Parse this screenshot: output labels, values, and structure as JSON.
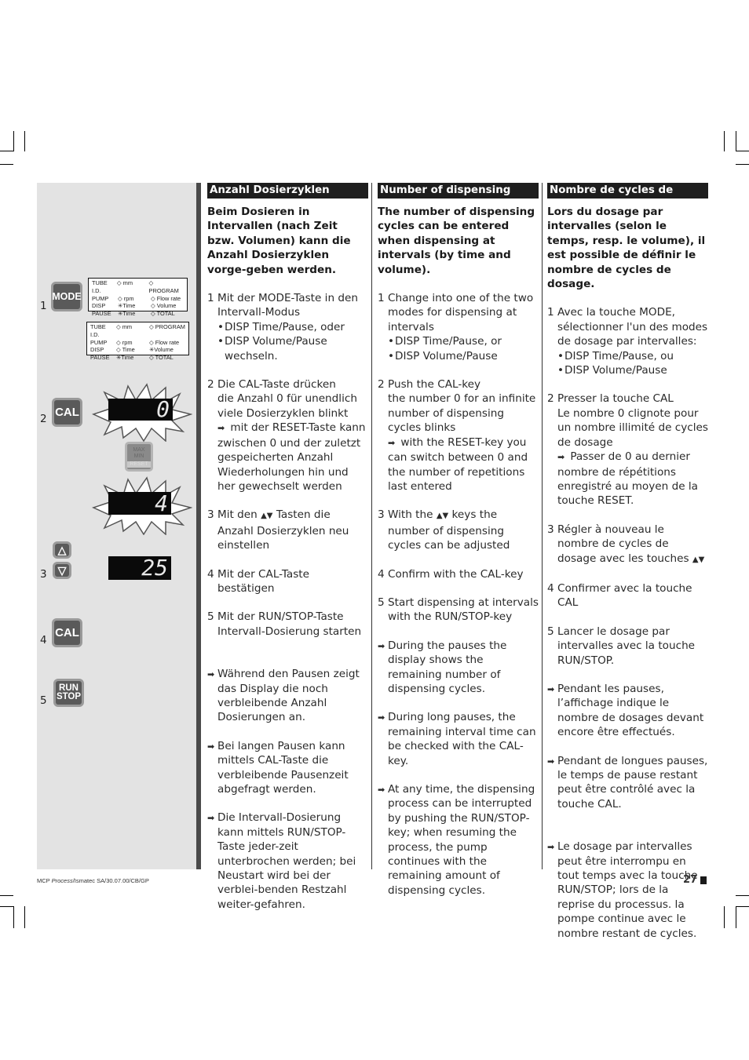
{
  "sidebar": {
    "steps": [
      {
        "num": "1",
        "key": "MODE"
      },
      {
        "num": "2",
        "key": "CAL"
      },
      {
        "num": "3",
        "key_up": "△",
        "key_down": "▽"
      },
      {
        "num": "4",
        "key": "CAL"
      },
      {
        "num": "5",
        "key_line1": "RUN",
        "key_line2": "STOP"
      }
    ],
    "mode_panel_1": {
      "rows": [
        {
          "label": "TUBE I.D.",
          "mid_mark": "◇",
          "mid": "mm",
          "right_mark": "◇",
          "right": "PROGRAM"
        },
        {
          "label": "PUMP",
          "mid_mark": "◇",
          "mid": "rpm",
          "right_mark": "◇",
          "right": "Flow rate"
        },
        {
          "label": "DISP",
          "mid_mark": "✳",
          "mid": "Time",
          "right_mark": "◇",
          "right": "Volume"
        },
        {
          "label": "PAUSE",
          "mid_mark": "✳",
          "mid": "Time",
          "right_mark": "◇",
          "right": "TOTAL"
        }
      ]
    },
    "mode_panel_2": {
      "rows": [
        {
          "label": "TUBE I.D.",
          "mid_mark": "◇",
          "mid": "mm",
          "right_mark": "◇",
          "right": "PROGRAM"
        },
        {
          "label": "PUMP",
          "mid_mark": "◇",
          "mid": "rpm",
          "right_mark": "◇",
          "right": "Flow rate"
        },
        {
          "label": "DISP",
          "mid_mark": "◇",
          "mid": "Time",
          "right_mark": "✳",
          "right": "Volume"
        },
        {
          "label": "PAUSE",
          "mid_mark": "✳",
          "mid": "Time",
          "right_mark": "◇",
          "right": "TOTAL"
        }
      ]
    },
    "display_1": "0",
    "reset_key": {
      "line1": "MAX",
      "line2": "MIN",
      "line3": "RESET"
    },
    "display_2": "4",
    "display_3": "25"
  },
  "columns": [
    {
      "header": "Anzahl Dosierzyklen",
      "intro": "Beim Dosieren in Intervallen (nach Zeit bzw. Volumen) kann die Anzahl Dosierzyklen vorge-geben werden.",
      "step1": {
        "num": "1",
        "text": "Mit der MODE-Taste in den Intervall-Modus",
        "bullets": [
          "DISP Time/Pause, oder",
          "DISP Volume/Pause"
        ],
        "tail": "wechseln."
      },
      "step2": {
        "num": "2",
        "line1": "Die CAL-Taste drücken",
        "line2": "die Anzahl 0 für unendlich viele Dosierzyklen blinkt",
        "arrow_text": "mit der RESET-Taste kann zwischen 0 und der zuletzt gespeicherten Anzahl Wiederholungen hin und her gewechselt werden"
      },
      "step3": {
        "num": "3",
        "pre": "Mit den",
        "arrows": "▲▼",
        "post": "Tasten die Anzahl Dosierzyklen neu einstellen"
      },
      "step4": {
        "num": "4",
        "text": "Mit der CAL-Taste bestätigen"
      },
      "step5": {
        "num": "5",
        "text": "Mit der RUN/STOP-Taste Intervall-Dosierung starten"
      },
      "notes": [
        "Während den Pausen zeigt das Display die noch verbleibende Anzahl Dosierungen an.",
        "Bei langen Pausen kann mittels CAL-Taste die verbleibende Pausenzeit abgefragt werden.",
        "Die Intervall-Dosierung kann mittels RUN/STOP-Taste jeder-zeit unterbrochen werden; bei Neustart wird bei der verblei-benden Restzahl weiter-gefahren."
      ]
    },
    {
      "header": "Number of dispensing cycles",
      "intro": "The number of dispensing cycles can be entered when dispensing at intervals (by time and volume).",
      "step1": {
        "num": "1",
        "text": "Change into one of the two modes for dispensing at intervals",
        "bullets": [
          "DISP Time/Pause, or",
          "DISP Volume/Pause"
        ],
        "tail": ""
      },
      "step2": {
        "num": "2",
        "line1": "Push the CAL-key",
        "line2": "the number 0 for an infinite number of dispensing cycles blinks",
        "arrow_text": "with the RESET-key you can switch between 0 and the number of repetitions last entered"
      },
      "step3": {
        "num": "3",
        "pre": "With the",
        "arrows": "▲▼",
        "post": "keys the number of dispensing cycles can be adjusted"
      },
      "step4": {
        "num": "4",
        "text": "Confirm with the CAL-key"
      },
      "step5": {
        "num": "5",
        "text": "Start dispensing at intervals with the RUN/STOP-key"
      },
      "notes": [
        "During the pauses the display shows the remaining number of dispensing cycles.",
        "During long pauses, the remaining interval time can be checked with the CAL-key.",
        "At any time, the dispensing process can be interrupted by pushing the RUN/STOP-key; when resuming the process, the pump continues with the remaining amount of dispensing cycles."
      ]
    },
    {
      "header": "Nombre de cycles de dosage",
      "intro": "Lors du dosage par intervalles (selon le temps, resp. le volume), il est possible de définir le nombre de cycles de dosage.",
      "step1": {
        "num": "1",
        "text": "Avec la touche MODE, sélectionner l'un des modes de dosage par intervalles:",
        "bullets": [
          "DISP Time/Pause, ou",
          "DISP Volume/Pause"
        ],
        "tail": ""
      },
      "step2": {
        "num": "2",
        "line1": "Presser la touche CAL",
        "line2": "Le nombre 0 clignote pour un nombre illimité de cycles de dosage",
        "arrow_text": "Passer de 0 au dernier nombre de répétitions enregistré au moyen de la touche RESET."
      },
      "step3": {
        "num": "3",
        "pre": "Régler à nouveau le nombre de cycles de dosage avec les touches",
        "arrows": "▲▼",
        "post": ""
      },
      "step4": {
        "num": "4",
        "text": "Confirmer avec la touche CAL"
      },
      "step5": {
        "num": "5",
        "text": "Lancer le dosage par intervalles avec la touche RUN/STOP."
      },
      "notes": [
        "Pendant les pauses, l’affichage indique le nombre de dosages devant encore être effectués.",
        "Pendant de longues pauses, le temps de pause restant peut être contrôlé avec la touche CAL.",
        "Le dosage par intervalles peut être interrompu en tout temps avec la touche RUN/STOP; lors de la reprise du processus. la pompe continue avec le nombre restant de cycles."
      ]
    }
  ],
  "footer": {
    "ref_prefix": "MCP ",
    "ref_italic": "Process",
    "ref_suffix": "/Ismatec SA/30.07.00/CB/GP",
    "page_number": "27"
  }
}
